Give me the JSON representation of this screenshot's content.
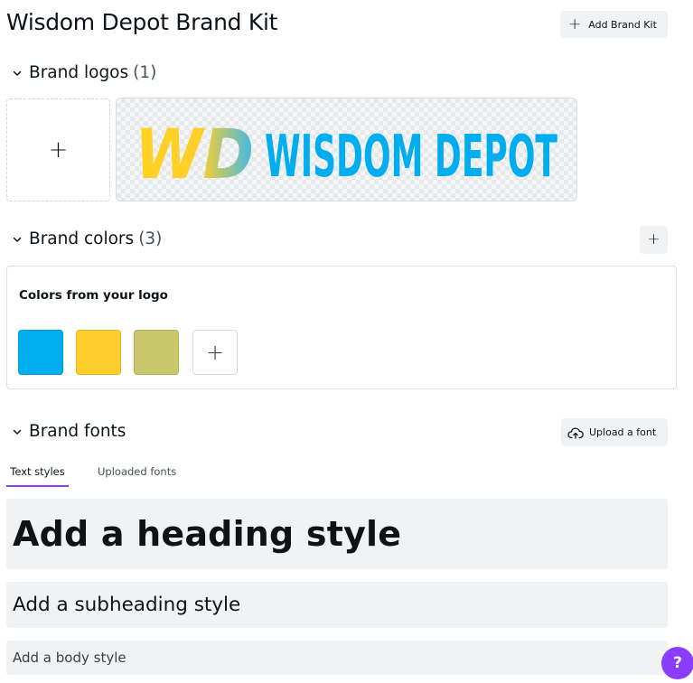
{
  "page": {
    "title": "Wisdom Depot Brand Kit"
  },
  "header": {
    "add_brand_kit_label": "Add Brand Kit"
  },
  "logos": {
    "title": "Brand logos",
    "count": "(1)",
    "add_glyph": "+",
    "logo_text": "WISDOM DEPOT",
    "logo_monogram": "WD"
  },
  "colors": {
    "title": "Brand colors",
    "count": "(3)",
    "add_glyph": "+",
    "panel_label": "Colors from your logo",
    "swatches": [
      "#00aeef",
      "#ffcd29",
      "#c9c96b"
    ]
  },
  "fonts": {
    "title": "Brand fonts",
    "upload_label": "Upload a font",
    "tabs": [
      "Text styles",
      "Uploaded fonts"
    ],
    "heading_placeholder": "Add a heading style",
    "subheading_placeholder": "Add a subheading style",
    "body_placeholder": "Add a body style"
  },
  "help": {
    "label": "?"
  },
  "theme": {
    "accent": "#8b3dff",
    "button_bg": "#f1f2f4"
  }
}
